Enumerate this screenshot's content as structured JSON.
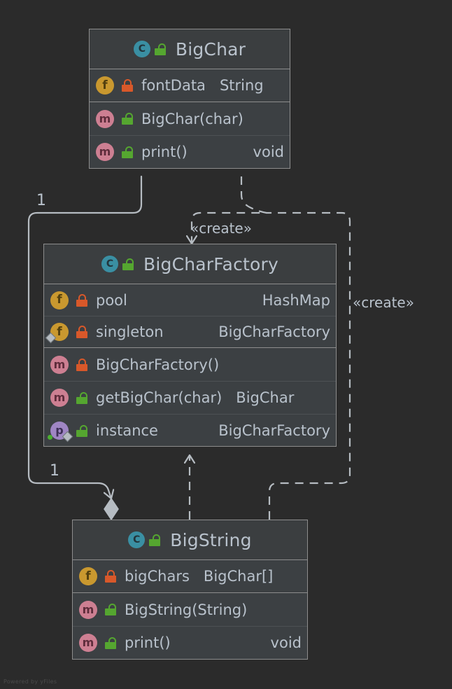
{
  "diagram": {
    "kind": "uml-class-diagram",
    "background_color": "#2b2b2b",
    "watermark": "Powered by yFiles",
    "edge_color": "#b6bcc2",
    "text_color": "#b9c2cc"
  },
  "classes": [
    {
      "id": "bigchar",
      "name": "BigChar",
      "icon": "class-icon",
      "visibility_icon": "unlocked-icon",
      "fields": [
        {
          "icon": "field-icon",
          "visibility_icon": "locked-icon",
          "name": "fontData",
          "type": "String"
        }
      ],
      "methods": [
        {
          "icon": "method-icon",
          "visibility_icon": "unlocked-icon",
          "name": "BigChar(char)",
          "type": ""
        },
        {
          "icon": "method-icon",
          "visibility_icon": "unlocked-icon",
          "name": "print()",
          "type": "void"
        }
      ]
    },
    {
      "id": "bigcharfactory",
      "name": "BigCharFactory",
      "icon": "class-icon",
      "visibility_icon": "unlocked-icon",
      "fields": [
        {
          "icon": "field-icon",
          "visibility_icon": "locked-icon",
          "name": "pool",
          "type": "HashMap"
        },
        {
          "icon": "field-icon",
          "visibility_icon": "locked-icon",
          "name": "singleton",
          "type": "BigCharFactory",
          "marker": "static-diamond"
        }
      ],
      "methods": [
        {
          "icon": "method-icon",
          "visibility_icon": "locked-icon",
          "name": "BigCharFactory()",
          "type": ""
        },
        {
          "icon": "method-icon",
          "visibility_icon": "unlocked-icon",
          "name": "getBigChar(char)",
          "type": "BigChar"
        },
        {
          "icon": "property-icon",
          "visibility_icon": "unlocked-icon",
          "name": "instance",
          "type": "BigCharFactory",
          "marker": "static-diamond-dot"
        }
      ]
    },
    {
      "id": "bigstring",
      "name": "BigString",
      "icon": "class-icon",
      "visibility_icon": "unlocked-icon",
      "fields": [
        {
          "icon": "field-icon",
          "visibility_icon": "locked-icon",
          "name": "bigChars",
          "type": "BigChar[]"
        }
      ],
      "methods": [
        {
          "icon": "method-icon",
          "visibility_icon": "unlocked-icon",
          "name": "BigString(String)",
          "type": ""
        },
        {
          "icon": "method-icon",
          "visibility_icon": "unlocked-icon",
          "name": "print()",
          "type": "void"
        }
      ]
    }
  ],
  "edges": [
    {
      "id": "edge-factory-uses-bigchar",
      "from": "bigcharfactory",
      "to": "bigchar",
      "style": "solid",
      "arrow": "open",
      "source_decoration": "filled-diamond",
      "labels": [
        "1",
        "1"
      ]
    },
    {
      "id": "edge-factory-creates-bigchar",
      "from": "bigcharfactory",
      "to": "bigchar",
      "style": "dashed",
      "arrow": "open",
      "label": "«create»"
    },
    {
      "id": "edge-bigstring-creates-bigchar",
      "from": "bigstring",
      "to": "bigchar",
      "style": "dashed",
      "arrow": "open",
      "label": "«create»"
    },
    {
      "id": "edge-bigstring-uses-factory",
      "from": "bigstring",
      "to": "bigcharfactory",
      "style": "dashed",
      "arrow": "open",
      "label": ""
    }
  ],
  "edge_labels": {
    "create_top": "«create»",
    "create_right": "«create»",
    "multiplicity_top": "1",
    "multiplicity_bottom": "1"
  },
  "icon_glyphs": {
    "class-icon": "C",
    "field-icon": "f",
    "method-icon": "m",
    "property-icon": "p"
  },
  "colors": {
    "class_icon": "#3a8fa3",
    "field_icon": "#c9982f",
    "method_icon": "#cd7f92",
    "property_icon": "#9f86c4",
    "lock_public": "#55a630",
    "lock_private": "#d8582a",
    "box_header": "#3b3e40",
    "box_body": "#3c4043",
    "box_border": "#8d8d8d"
  }
}
